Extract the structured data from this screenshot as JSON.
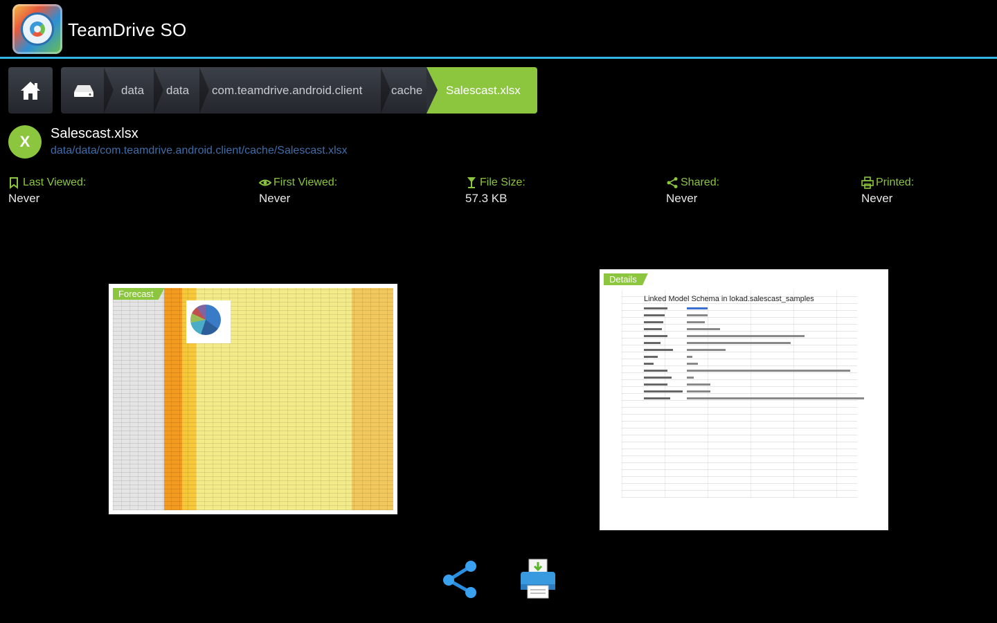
{
  "app": {
    "title": "TeamDrive SO"
  },
  "breadcrumb": {
    "items": [
      "data",
      "data",
      "com.teamdrive.android.client",
      "cache"
    ],
    "current": "Salescast.xlsx"
  },
  "file": {
    "badge": "X",
    "name": "Salescast.xlsx",
    "path": "data/data/com.teamdrive.android.client/cache/Salescast.xlsx"
  },
  "stats": {
    "last_viewed": {
      "label": "Last Viewed:",
      "value": "Never",
      "icon": "bookmark-icon"
    },
    "first_viewed": {
      "label": "First Viewed:",
      "value": "Never",
      "icon": "eye-icon"
    },
    "file_size": {
      "label": "File Size:",
      "value": "57.3 KB",
      "icon": "size-icon"
    },
    "shared": {
      "label": "Shared:",
      "value": "Never",
      "icon": "share-icon"
    },
    "printed": {
      "label": "Printed:",
      "value": "Never",
      "icon": "printer-icon"
    }
  },
  "previews": {
    "sheet1": {
      "tab": "Forecast"
    },
    "sheet2": {
      "tab": "Details",
      "heading": "Linked Model Schema in lokad.salescast_samples"
    }
  },
  "colors": {
    "accent": "#8cc63f",
    "actionbar_line": "#33b5e5",
    "path_link": "#3f6da8"
  }
}
